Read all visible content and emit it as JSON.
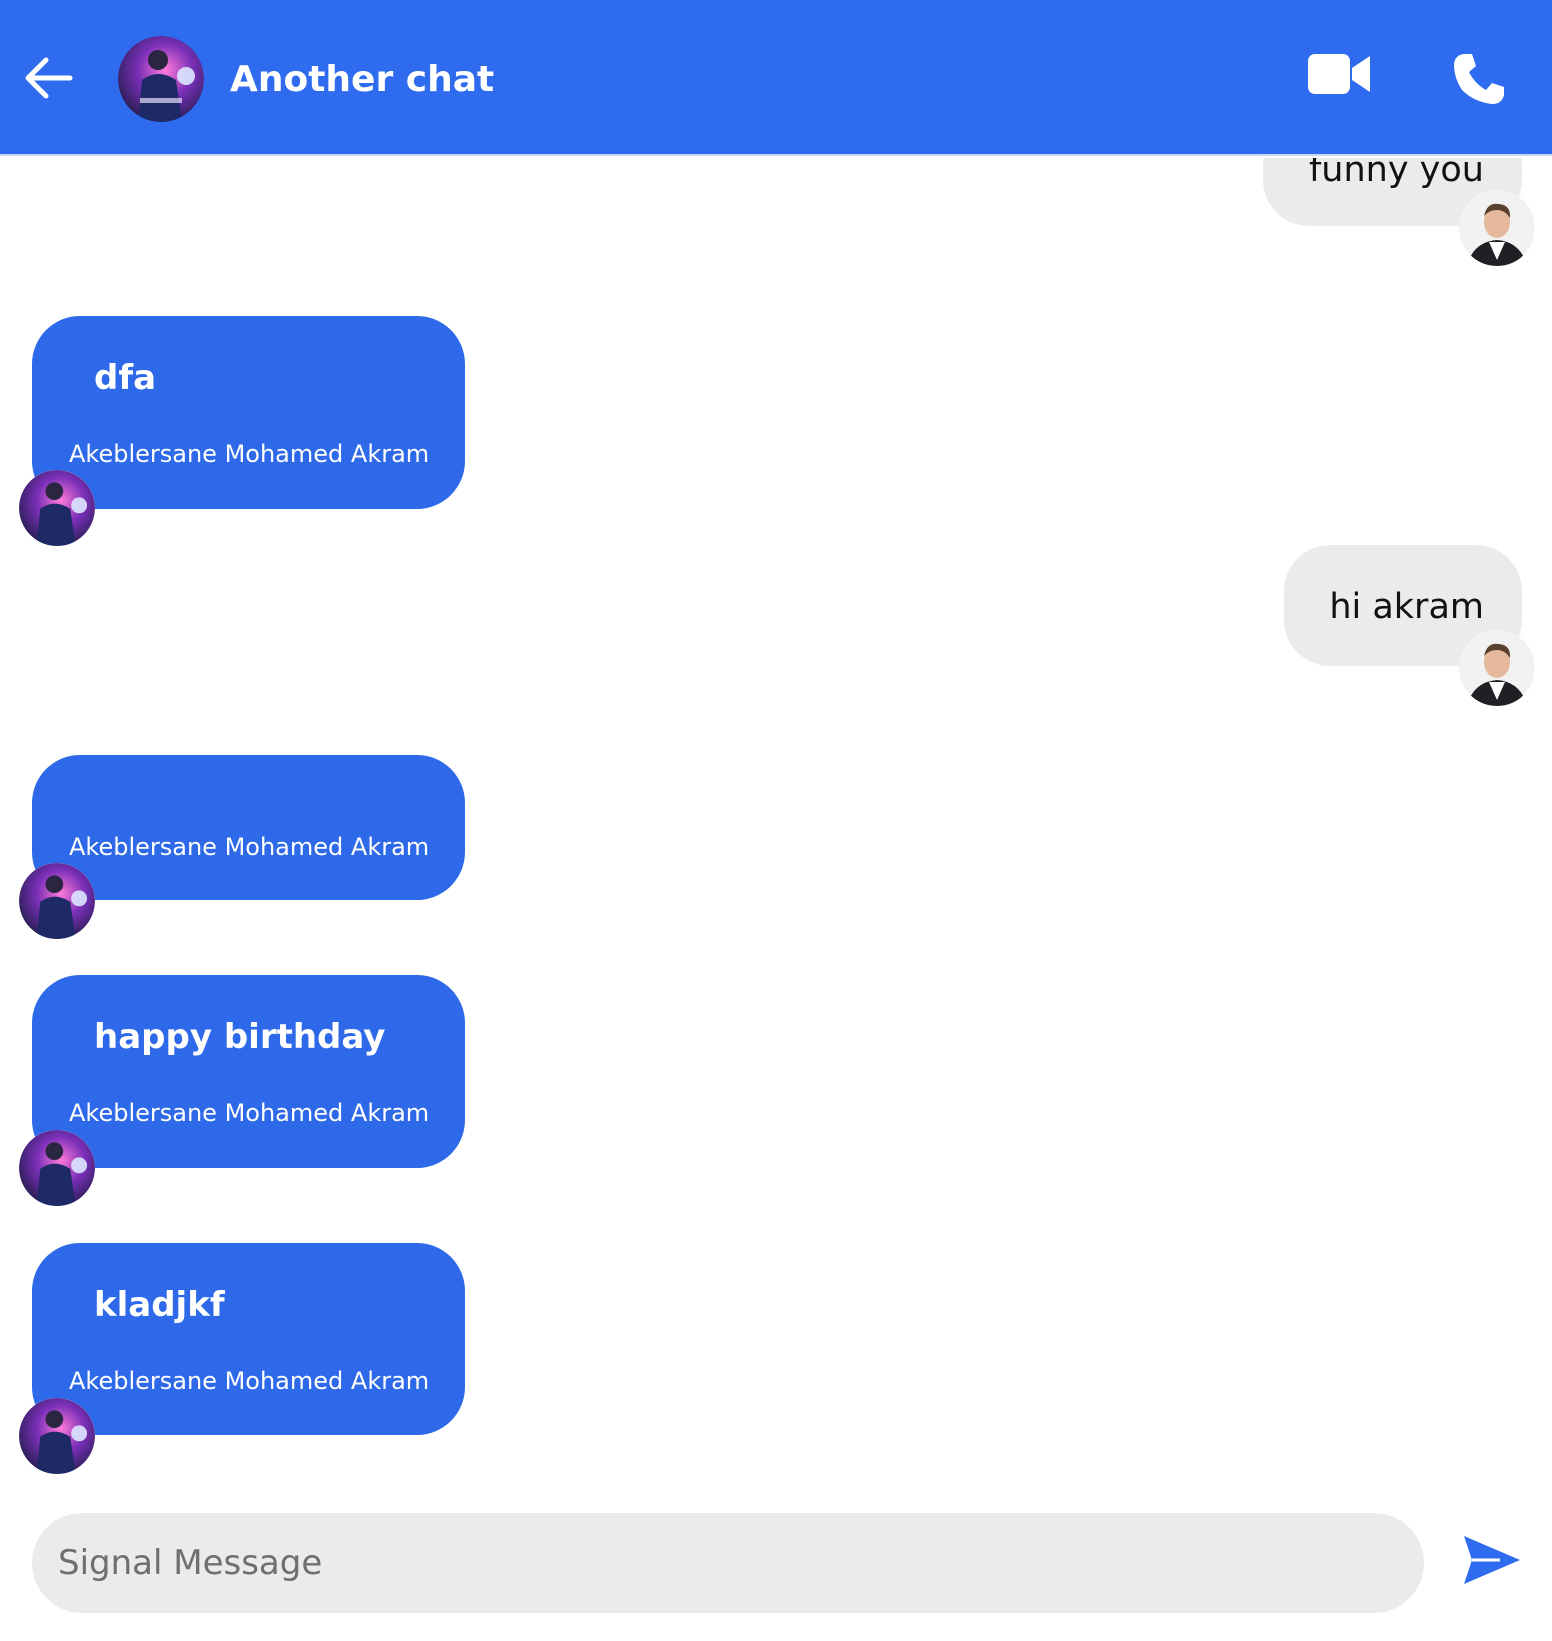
{
  "header": {
    "title": "Another chat",
    "color": "#2F6BEF"
  },
  "messages": [
    {
      "direction": "outgoing",
      "text": "funny you"
    },
    {
      "direction": "incoming",
      "text": "dfa",
      "sender": "Akeblersane Mohamed Akram"
    },
    {
      "direction": "outgoing",
      "text": "hi akram"
    },
    {
      "direction": "incoming",
      "text": "",
      "sender": "Akeblersane Mohamed Akram"
    },
    {
      "direction": "incoming",
      "text": "happy birthday",
      "sender": "Akeblersane Mohamed Akram"
    },
    {
      "direction": "incoming",
      "text": "kladjkf",
      "sender": "Akeblersane Mohamed Akram"
    }
  ],
  "composer": {
    "placeholder": "Signal Message",
    "value": ""
  },
  "icons": {
    "back": "arrow-left-icon",
    "video": "video-camera-icon",
    "phone": "phone-icon",
    "send": "send-icon"
  },
  "colors": {
    "accent": "#2F6BEF",
    "incoming_bubble": "#2D69E8",
    "outgoing_bubble": "#EBEBEB",
    "composer_bg": "#EBEBEB"
  }
}
